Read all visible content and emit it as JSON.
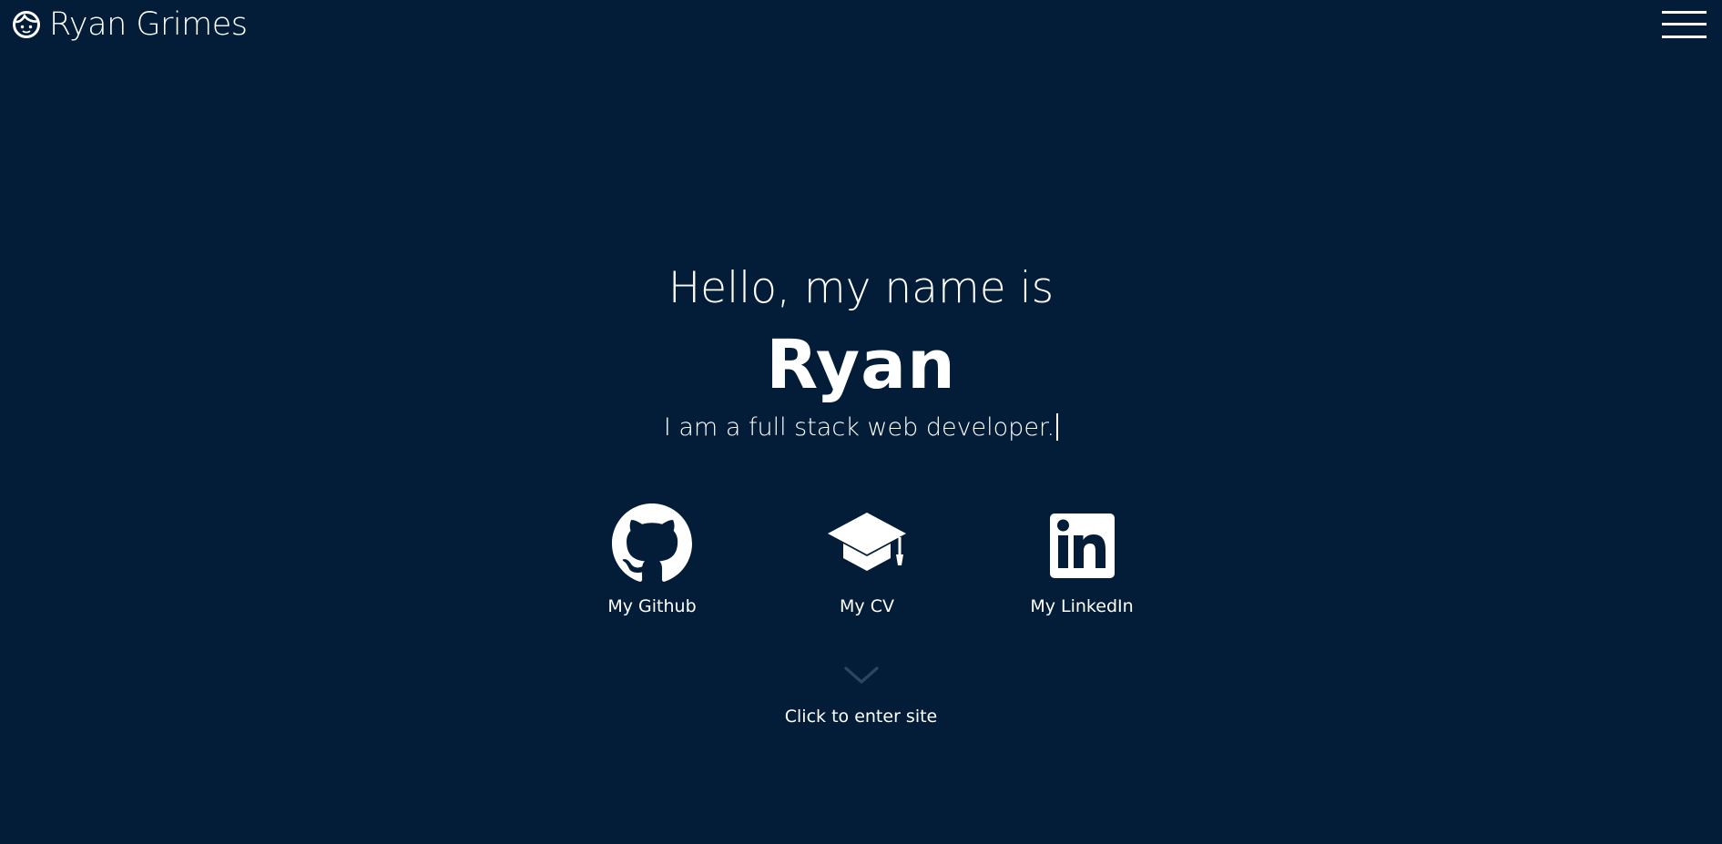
{
  "header": {
    "brand_title": "Ryan Grimes",
    "brand_icon": "smiley-face-icon",
    "menu_icon": "hamburger-menu-icon"
  },
  "hero": {
    "greeting": "Hello, my name is",
    "name": "Ryan",
    "tagline": "I am a full stack web developer."
  },
  "links": [
    {
      "label": "My Github",
      "icon": "github-icon"
    },
    {
      "label": "My CV",
      "icon": "graduation-cap-icon"
    },
    {
      "label": "My LinkedIn",
      "icon": "linkedin-icon"
    }
  ],
  "enter": {
    "label": "Click to enter site",
    "icon": "chevron-down-icon"
  },
  "colors": {
    "background": "#031d38",
    "text": "#ffffff",
    "chevron": "#2d4560"
  }
}
